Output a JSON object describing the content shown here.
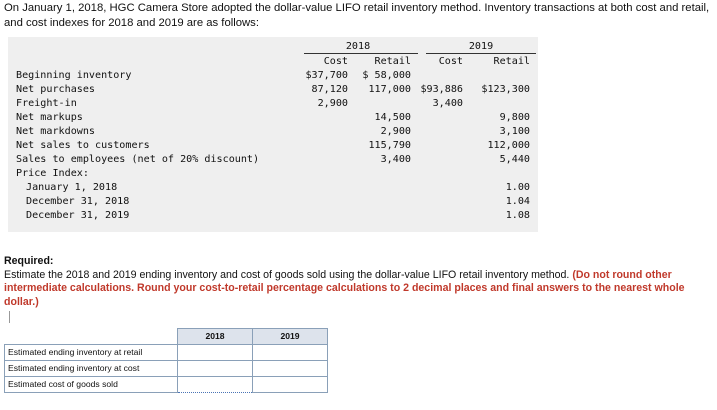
{
  "intro": "On January 1, 2018, HGC Camera Store adopted the dollar-value LIFO retail inventory method. Inventory transactions at both cost and retail, and cost indexes for 2018 and 2019 are as follows:",
  "table": {
    "years": [
      "2018",
      "2019"
    ],
    "col_heads": [
      "Cost",
      "Retail",
      "Cost",
      "Retail"
    ],
    "rows": [
      {
        "label": "Beginning inventory",
        "values": [
          "$37,700",
          "$ 58,000",
          "",
          ""
        ]
      },
      {
        "label": "Net purchases",
        "values": [
          "87,120",
          "117,000",
          "$93,886",
          "$123,300"
        ]
      },
      {
        "label": "Freight-in",
        "values": [
          "2,900",
          "",
          "3,400",
          ""
        ]
      },
      {
        "label": "Net markups",
        "values": [
          "",
          "14,500",
          "",
          "9,800"
        ]
      },
      {
        "label": "Net markdowns",
        "values": [
          "",
          "2,900",
          "",
          "3,100"
        ]
      },
      {
        "label": "Net sales to customers",
        "values": [
          "",
          "115,790",
          "",
          "112,000"
        ]
      },
      {
        "label": "Sales to employees (net of 20% discount)",
        "values": [
          "",
          "3,400",
          "",
          "5,440"
        ]
      },
      {
        "label": "Price Index:",
        "values": [
          "",
          "",
          "",
          ""
        ]
      },
      {
        "label": "January 1, 2018",
        "values": [
          "",
          "",
          "",
          "1.00"
        ]
      },
      {
        "label": "December 31, 2018",
        "values": [
          "",
          "",
          "",
          "1.04"
        ]
      },
      {
        "label": "December 31, 2019",
        "values": [
          "",
          "",
          "",
          "1.08"
        ]
      }
    ]
  },
  "required": {
    "title": "Required:",
    "text": "Estimate the 2018 and 2019 ending inventory and cost of goods sold using the dollar-value LIFO retail inventory method.",
    "instructions": "(Do not round other intermediate calculations. Round your cost-to-retail percentage calculations to 2 decimal places and final answers to the nearest whole dollar.)"
  },
  "answer": {
    "heads": [
      "2018",
      "2019"
    ],
    "rows": [
      "Estimated ending inventory at retail",
      "Estimated ending inventory at cost",
      "Estimated cost of goods sold"
    ]
  }
}
